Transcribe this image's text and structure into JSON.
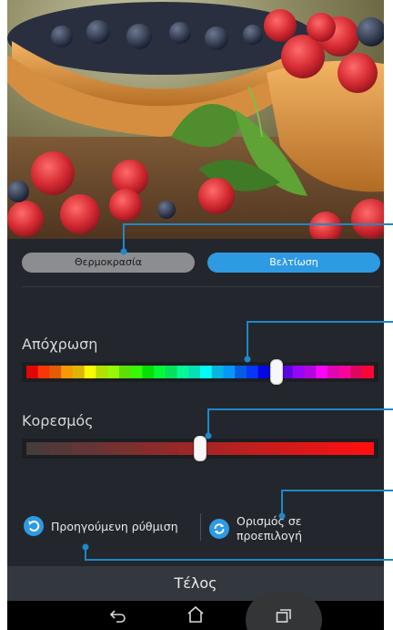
{
  "tabs": {
    "temperature": "Θερμοκρασία",
    "enhancement": "Βελτίωση",
    "active": "enhancement"
  },
  "sliders": {
    "hue": {
      "label": "Απόχρωση",
      "value": 0.72
    },
    "saturation": {
      "label": "Κορεσμός",
      "value": 0.5
    }
  },
  "actions": {
    "previous": "Προηγούμενη ρύθμιση",
    "preset_line1": "Ορισμός σε",
    "preset_line2": "προεπιλογή"
  },
  "footer": {
    "done": "Τέλος"
  },
  "nav_icons": [
    "back-icon",
    "home-icon",
    "recent-apps-icon"
  ],
  "colors": {
    "accent": "#2e9ae2",
    "callout": "#1e88c8",
    "panel": "#23272d"
  }
}
